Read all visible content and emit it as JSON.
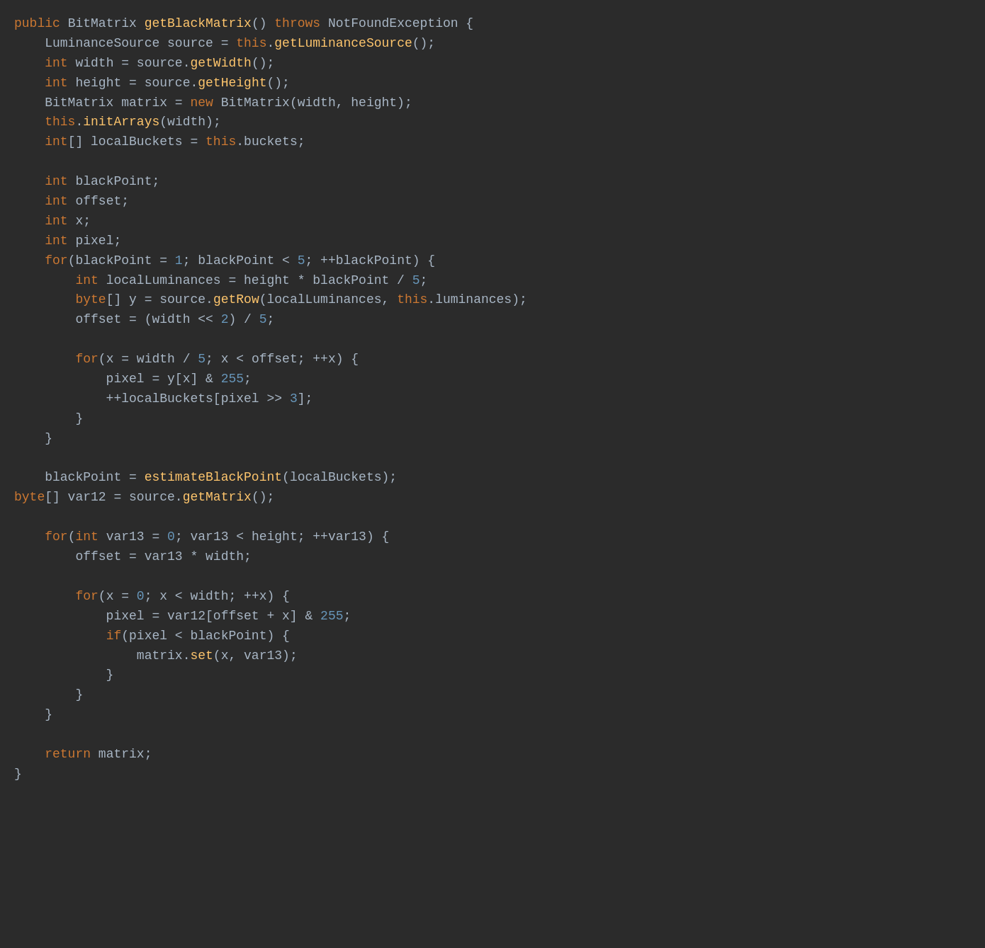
{
  "code": {
    "lines": [
      {
        "id": 1,
        "content": "public BitMatrix getBlackMatrix() throws NotFoundException {"
      },
      {
        "id": 2,
        "content": "    LuminanceSource source = this.getLuminanceSource();"
      },
      {
        "id": 3,
        "content": "    int width = source.getWidth();"
      },
      {
        "id": 4,
        "content": "    int height = source.getHeight();"
      },
      {
        "id": 5,
        "content": "    BitMatrix matrix = new BitMatrix(width, height);"
      },
      {
        "id": 6,
        "content": "    this.initArrays(width);"
      },
      {
        "id": 7,
        "content": "    int[] localBuckets = this.buckets;"
      },
      {
        "id": 8,
        "content": ""
      },
      {
        "id": 9,
        "content": "    int blackPoint;"
      },
      {
        "id": 10,
        "content": "    int offset;"
      },
      {
        "id": 11,
        "content": "    int x;"
      },
      {
        "id": 12,
        "content": "    int pixel;"
      },
      {
        "id": 13,
        "content": "    for(blackPoint = 1; blackPoint < 5; ++blackPoint) {"
      },
      {
        "id": 14,
        "content": "        int localLuminances = height * blackPoint / 5;"
      },
      {
        "id": 15,
        "content": "        byte[] y = source.getRow(localLuminances, this.luminances);"
      },
      {
        "id": 16,
        "content": "        offset = (width << 2) / 5;"
      },
      {
        "id": 17,
        "content": ""
      },
      {
        "id": 18,
        "content": "        for(x = width / 5; x < offset; ++x) {"
      },
      {
        "id": 19,
        "content": "            pixel = y[x] & 255;"
      },
      {
        "id": 20,
        "content": "            ++localBuckets[pixel >> 3];"
      },
      {
        "id": 21,
        "content": "        }"
      },
      {
        "id": 22,
        "content": "    }"
      },
      {
        "id": 23,
        "content": ""
      },
      {
        "id": 24,
        "content": "    blackPoint = estimateBlackPoint(localBuckets);"
      },
      {
        "id": 25,
        "content": "    byte[] var12 = source.getMatrix();"
      },
      {
        "id": 26,
        "content": ""
      },
      {
        "id": 27,
        "content": "    for(int var13 = 0; var13 < height; ++var13) {"
      },
      {
        "id": 28,
        "content": "        offset = var13 * width;"
      },
      {
        "id": 29,
        "content": ""
      },
      {
        "id": 30,
        "content": "        for(x = 0; x < width; ++x) {"
      },
      {
        "id": 31,
        "content": "            pixel = var12[offset + x] & 255;"
      },
      {
        "id": 32,
        "content": "            if(pixel < blackPoint) {"
      },
      {
        "id": 33,
        "content": "                matrix.set(x, var13);"
      },
      {
        "id": 34,
        "content": "            }"
      },
      {
        "id": 35,
        "content": "        }"
      },
      {
        "id": 36,
        "content": "    }"
      },
      {
        "id": 37,
        "content": ""
      },
      {
        "id": 38,
        "content": "    return matrix;"
      },
      {
        "id": 39,
        "content": "}"
      }
    ]
  }
}
